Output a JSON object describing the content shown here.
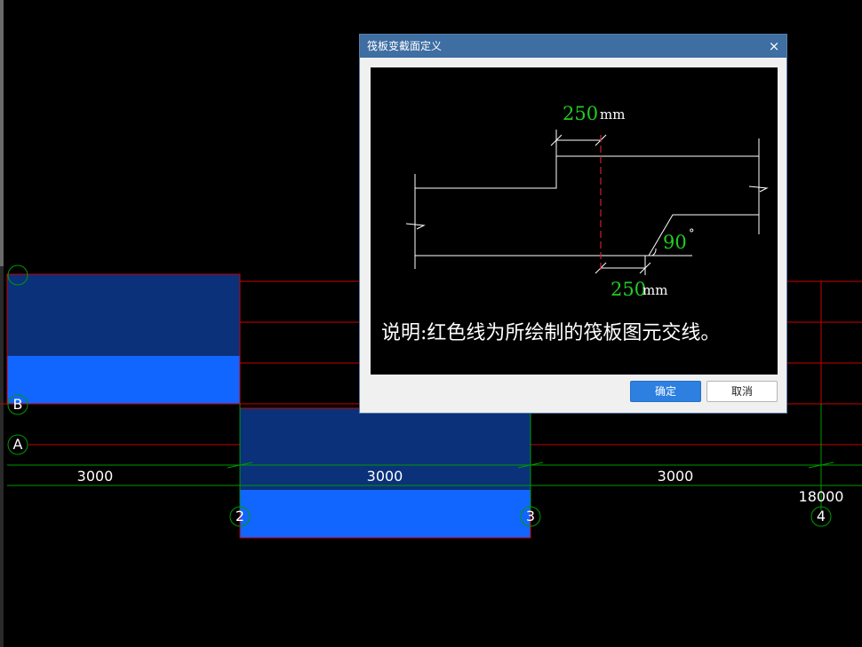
{
  "canvas": {
    "dimension_labels": [
      "3000",
      "3000",
      "3000"
    ],
    "total_dimension_label": "18000",
    "axis_numbers": [
      "2",
      "3",
      "4"
    ],
    "axis_letters": [
      "B",
      "A"
    ],
    "colors": {
      "dark_slab": "#0a3179",
      "light_slab": "#1166ff",
      "axis_line": "#cc0000",
      "dim_line": "#008800"
    }
  },
  "dialog": {
    "title": "筏板变截面定义",
    "close_glyph": "×",
    "preview": {
      "top_dim_value": "250",
      "top_dim_unit": "mm",
      "angle_value": "90",
      "angle_unit": "°",
      "bottom_dim_value": "250",
      "bottom_dim_unit": "mm",
      "note": "说明:红色线为所绘制的筏板图元交线。"
    },
    "ok_label": "确定",
    "cancel_label": "取消"
  }
}
